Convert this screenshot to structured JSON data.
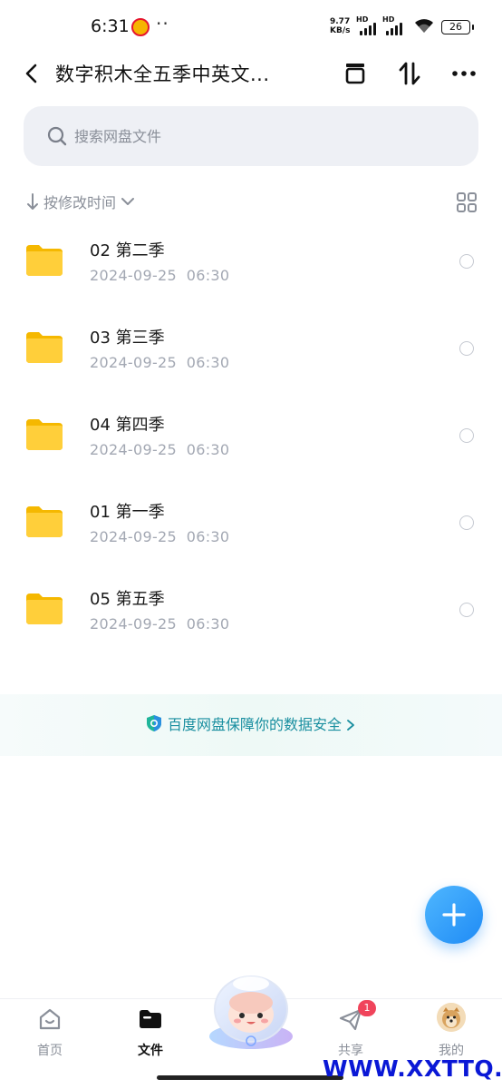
{
  "status_bar": {
    "time": "6:31",
    "overflow_dots": "··",
    "net_speed_value": "9.77",
    "net_speed_unit": "KB/s",
    "hd_label": "HD",
    "battery": "26"
  },
  "header": {
    "title": "数字积木全五季中英文..."
  },
  "search": {
    "placeholder": "搜索网盘文件",
    "value": ""
  },
  "sort": {
    "label": "按修改时间"
  },
  "files": [
    {
      "name": "02 第二季",
      "date": "2024-09-25",
      "time": "06:30"
    },
    {
      "name": "03 第三季",
      "date": "2024-09-25",
      "time": "06:30"
    },
    {
      "name": "04 第四季",
      "date": "2024-09-25",
      "time": "06:30"
    },
    {
      "name": "01 第一季",
      "date": "2024-09-25",
      "time": "06:30"
    },
    {
      "name": "05 第五季",
      "date": "2024-09-25",
      "time": "06:30"
    }
  ],
  "security_banner": {
    "text": "百度网盘保障你的数据安全"
  },
  "bottom_nav": {
    "items": [
      {
        "label": "首页",
        "icon": "home-icon"
      },
      {
        "label": "文件",
        "icon": "folder-icon"
      },
      {
        "label": "共享",
        "icon": "share-plane-icon"
      },
      {
        "label": "我的",
        "icon": "avatar"
      }
    ],
    "share_badge": "1"
  },
  "watermark": "WWW.XXTTQ.COM",
  "colors": {
    "accent": "#1f8bf5",
    "folder": "#ffc933",
    "badge": "#f0445b",
    "secondary_text": "#a3a8b3",
    "security_text": "#1a8fa0",
    "watermark": "#0a18d6"
  }
}
